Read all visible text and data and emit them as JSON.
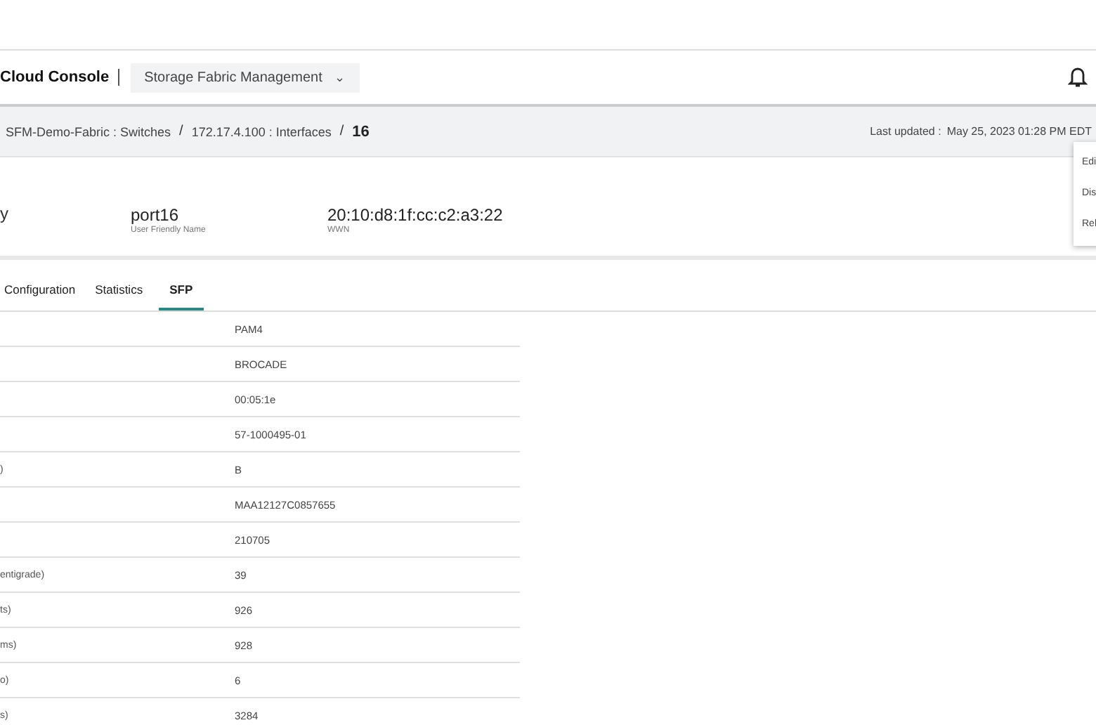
{
  "header": {
    "brand": "Cloud Console",
    "app_switcher": "Storage Fabric Management",
    "caret": "⌄"
  },
  "breadcrumb": {
    "items": [
      "SFM-Demo-Fabric : Switches",
      "172.17.4.100 : Interfaces",
      "16"
    ],
    "separator": "/",
    "last_updated_label": "Last updated :",
    "last_updated": "May 25, 2023 01:28 PM EDT"
  },
  "menu": {
    "items": [
      "Edi",
      "Dis",
      "Rel"
    ]
  },
  "details": {
    "cut_value": "y",
    "fields": [
      {
        "value": "port16",
        "label": "User Friendly Name"
      },
      {
        "value": "20:10:d8:1f:cc:c2:a3:22",
        "label": "WWN"
      }
    ]
  },
  "tabs": [
    {
      "label": "Configuration",
      "selected": false
    },
    {
      "label": "Statistics",
      "selected": false
    },
    {
      "label": "SFP",
      "selected": true
    }
  ],
  "rows": [
    {
      "value": "PAM4"
    },
    {
      "value": "BROCADE"
    },
    {
      "value": "00:05:1e"
    },
    {
      "value": "57-1000495-01"
    },
    {
      "label": ")",
      "value": "B"
    },
    {
      "value": "MAA12127C0857655"
    },
    {
      "value": "210705"
    },
    {
      "label": "entigrade)",
      "value": "39"
    },
    {
      "label": "ts)",
      "value": "926"
    },
    {
      "label": "ms)",
      "value": "928"
    },
    {
      "label": "o)",
      "value": "6"
    },
    {
      "label": "s)",
      "value": "3284"
    }
  ]
}
